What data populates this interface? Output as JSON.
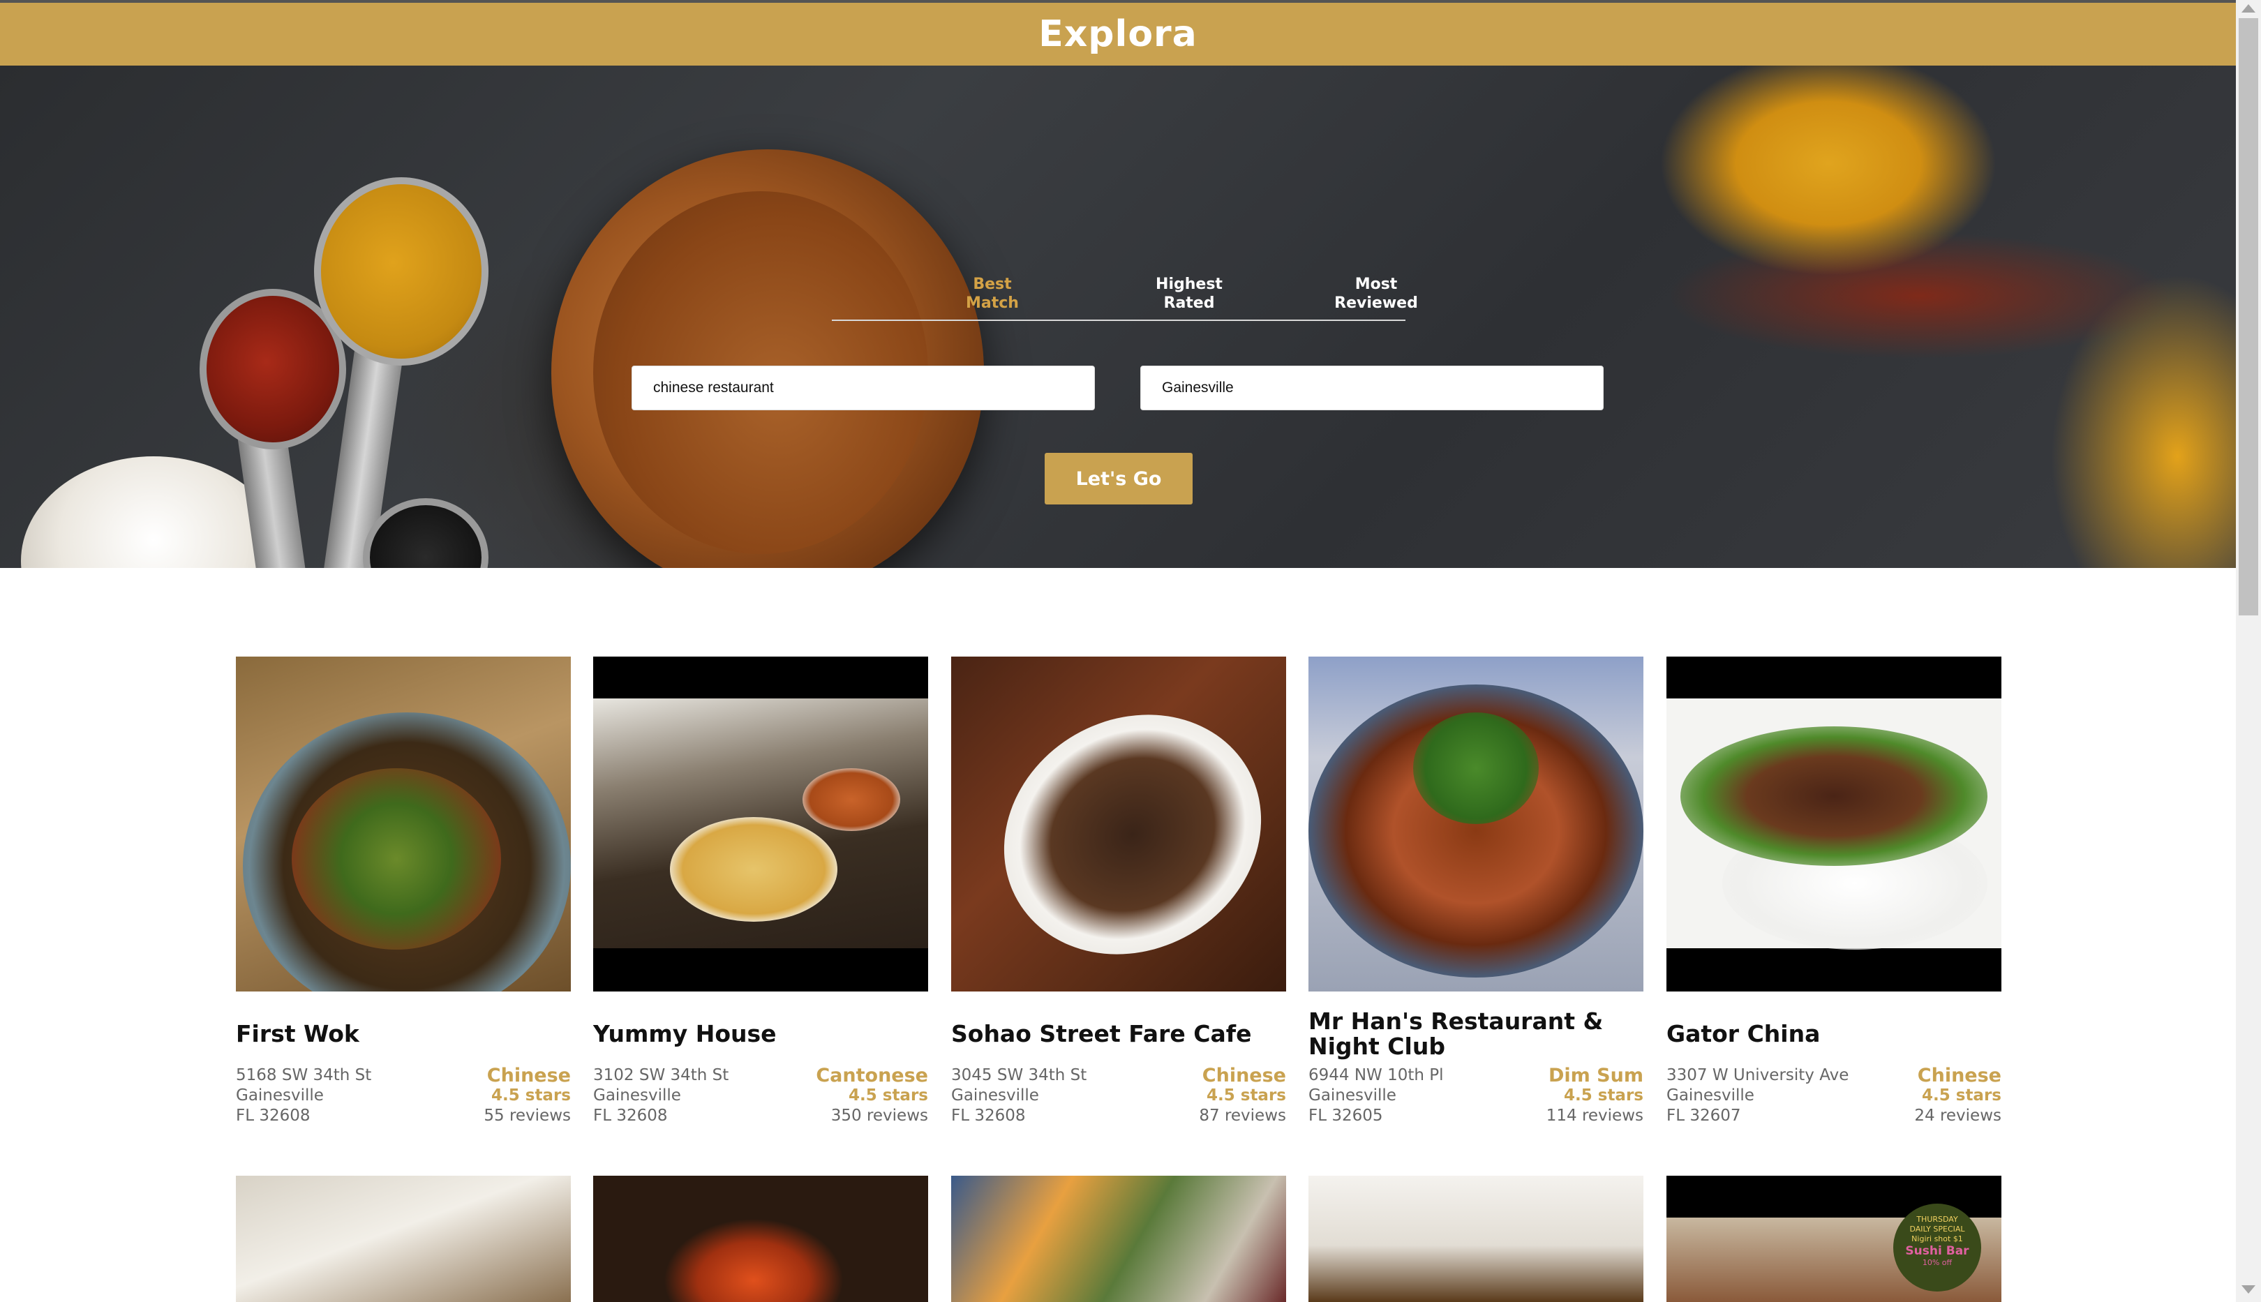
{
  "app": {
    "brand": "Explora"
  },
  "tabs": [
    {
      "label_line1": "Best",
      "label_line2": "Match",
      "active": true
    },
    {
      "label_line1": "Highest",
      "label_line2": "Rated",
      "active": false
    },
    {
      "label_line1": "Most",
      "label_line2": "Reviewed",
      "active": false
    }
  ],
  "search": {
    "term_value": "chinese restaurant",
    "location_value": "Gainesville",
    "button_label": "Let's Go"
  },
  "results": [
    {
      "name": "First Wok",
      "address": "5168 SW 34th St",
      "city": "Gainesville",
      "state_zip": "FL 32608",
      "category": "Chinese",
      "rating": "4.5 stars",
      "reviews": "55 reviews"
    },
    {
      "name": "Yummy House",
      "address": "3102 SW 34th St",
      "city": "Gainesville",
      "state_zip": "FL 32608",
      "category": "Cantonese",
      "rating": "4.5 stars",
      "reviews": "350 reviews"
    },
    {
      "name": "Sohao Street Fare Cafe",
      "address": "3045 SW 34th St",
      "city": "Gainesville",
      "state_zip": "FL 32608",
      "category": "Chinese",
      "rating": "4.5 stars",
      "reviews": "87 reviews"
    },
    {
      "name": "Mr Han's Restaurant & Night Club",
      "address": "6944 NW 10th Pl",
      "city": "Gainesville",
      "state_zip": "FL 32605",
      "category": "Dim Sum",
      "rating": "4.5 stars",
      "reviews": "114 reviews"
    },
    {
      "name": "Gator China",
      "address": "3307 W University Ave",
      "city": "Gainesville",
      "state_zip": "FL 32607",
      "category": "Chinese",
      "rating": "4.5 stars",
      "reviews": "24 reviews"
    }
  ],
  "partial_row_image_text": [
    "THURSDAY",
    "DAILY SPECIAL",
    "Nigiri shot $1",
    "Sushi Bar",
    "10% off"
  ],
  "colors": {
    "accent": "#c9a250",
    "header_bg": "#c9a250",
    "active_tab": "#d4a246"
  }
}
